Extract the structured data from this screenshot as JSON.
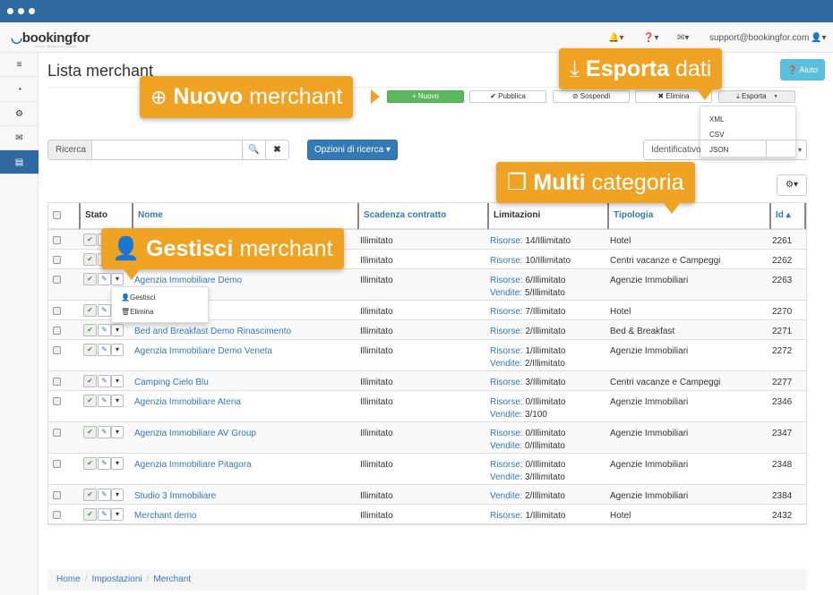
{
  "header": {
    "logo": "bookingfor",
    "logo_tagline": "LOCAL TRAVEL ALLIANCE",
    "user_email": "support@bookingfor.com",
    "icons": [
      "bell-icon",
      "question-icon",
      "envelope-icon",
      "user-icon"
    ]
  },
  "sidebar": {
    "items": [
      {
        "icon": "menu-icon",
        "glyph": "≡"
      },
      {
        "icon": "dashboard-icon",
        "glyph": "◔"
      },
      {
        "icon": "gear-icon",
        "glyph": "⚙"
      },
      {
        "icon": "envelope-icon",
        "glyph": "✉"
      },
      {
        "icon": "document-icon",
        "glyph": "▤",
        "active": true
      }
    ]
  },
  "page": {
    "title": "Lista merchant",
    "help": "❓ Aiuto"
  },
  "toolbar": {
    "nuovo": "+ Nuovo",
    "pubblica": "✔ Pubblica",
    "sospendi": "⊘ Sospendi",
    "elimina": "✖ Elimina",
    "esporta": "⤓ Esporta",
    "export_options": [
      "XML",
      "CSV",
      "JSON"
    ]
  },
  "search": {
    "label": "Ricerca",
    "value": "",
    "options": "Opzioni di ricerca ▾",
    "sort_field": "Identificativo",
    "sort_dir": "▾"
  },
  "table": {
    "headers": {
      "stato": "Stato",
      "nome": "Nome",
      "scadenza": "Scadenza contratto",
      "limitazioni": "Limitazioni",
      "tipologia": "Tipologia",
      "id": "Id ▴"
    },
    "rows": [
      {
        "nome": "",
        "scadenza": "Illimitato",
        "risorse": "14/Illimitato",
        "vendite": null,
        "tipologia": "Hotel",
        "id": "2261"
      },
      {
        "nome": "",
        "scadenza": "Illimitato",
        "risorse": "10/Illimitato",
        "vendite": null,
        "tipologia": "Centri vacanze e Campeggi",
        "id": "2262"
      },
      {
        "nome": "Agenzia Immobiliare Demo",
        "scadenza": "Illimitato",
        "risorse": "6/Illimitato",
        "vendite": "5/Illimitato",
        "tipologia": "Agenzie Immobiliari",
        "id": "2263"
      },
      {
        "nome": "",
        "scadenza": "Illimitato",
        "risorse": "7/Illimitato",
        "vendite": null,
        "tipologia": "Hotel",
        "id": "2270"
      },
      {
        "nome": "Bed and Breakfast Demo Rinascimento",
        "scadenza": "Illimitato",
        "risorse": "2/Illimitato",
        "vendite": null,
        "tipologia": "Bed & Breakfast",
        "id": "2271"
      },
      {
        "nome": "Agenzia Immobiliare Demo Veneta",
        "scadenza": "Illimitato",
        "risorse": "1/Illimitato",
        "vendite": "2/Illimitato",
        "tipologia": "Agenzie Immobiliari",
        "id": "2272"
      },
      {
        "nome": "Camping Cielo Blu",
        "scadenza": "Illimitato",
        "risorse": "3/Illimitato",
        "vendite": null,
        "tipologia": "Centri vacanze e Campeggi",
        "id": "2277"
      },
      {
        "nome": "Agenzia Immobiliare Atena",
        "scadenza": "Illimitato",
        "risorse": "0/Illimitato",
        "vendite": "3/100",
        "tipologia": "Agenzie Immobiliari",
        "id": "2346"
      },
      {
        "nome": "Agenzia Immobiliare AV Group",
        "scadenza": "Illimitato",
        "risorse": "0/Illimitato",
        "vendite": "0/Illimitato",
        "tipologia": "Agenzie Immobiliari",
        "id": "2347"
      },
      {
        "nome": "Agenzia Immobiliare Pitagora",
        "scadenza": "Illimitato",
        "risorse": "0/Illimitato",
        "vendite": "3/Illimitato",
        "tipologia": "Agenzie Immobiliari",
        "id": "2348"
      },
      {
        "nome": "Studio 3 Immobiliare",
        "scadenza": "Illimitato",
        "risorse": null,
        "vendite": "2/Illimitato",
        "tipologia": "Agenzie Immobiliari",
        "id": "2384"
      },
      {
        "nome": "Merchant demo",
        "scadenza": "Illimitato",
        "risorse": "1/Illimitato",
        "vendite": null,
        "tipologia": "Hotel",
        "id": "2432"
      }
    ],
    "risorse_label": "Risorse:",
    "vendite_label": "Vendite:",
    "row_menu": [
      "Gestisci",
      "Elimina"
    ]
  },
  "callouts": {
    "nuovo": {
      "bold": "Nuovo",
      "rest": " merchant"
    },
    "esporta": {
      "bold": "Esporta",
      "rest": " dati"
    },
    "multi": {
      "bold": "Multi",
      "rest": " categoria"
    },
    "gestisci": {
      "bold": "Gestisci",
      "rest": " merchant"
    }
  },
  "breadcrumb": [
    "Home",
    "Impostazioni",
    "Merchant"
  ],
  "colors": {
    "accent": "#f0a322",
    "primary": "#337ab7",
    "success": "#5cb85c",
    "info": "#5bc0de",
    "topbar": "#2e6aa0"
  }
}
